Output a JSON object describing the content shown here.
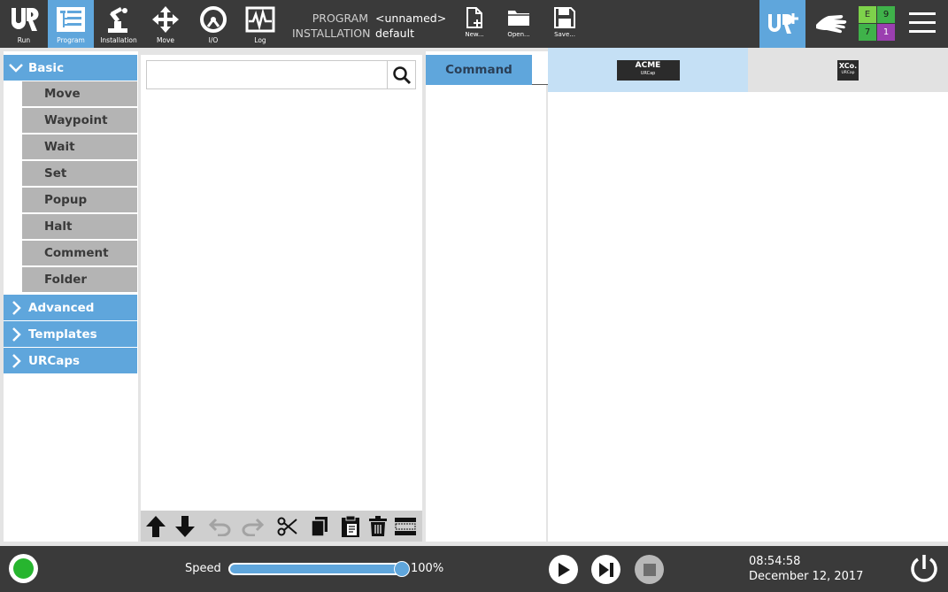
{
  "topbar": {
    "nav": [
      {
        "label": "Run",
        "icon": "ur-logo-icon"
      },
      {
        "label": "Program",
        "icon": "program-tree-icon",
        "active": true
      },
      {
        "label": "Installation",
        "icon": "robot-arm-icon"
      },
      {
        "label": "Move",
        "icon": "move-arrows-icon"
      },
      {
        "label": "I/O",
        "icon": "io-gauge-icon"
      },
      {
        "label": "Log",
        "icon": "log-chart-icon"
      }
    ],
    "program_key": "PROGRAM",
    "program_value": "<unnamed>",
    "installation_key": "INSTALLATION",
    "installation_value": "default",
    "file_actions": [
      {
        "label": "New...",
        "icon": "new-file-icon"
      },
      {
        "label": "Open...",
        "icon": "folder-icon"
      },
      {
        "label": "Save...",
        "icon": "save-icon"
      }
    ],
    "status": {
      "e": "E",
      "e_count": "9",
      "w": "7",
      "w_count": "1",
      "colors": {
        "green_light": "#7ed24b",
        "green": "#3fb24a",
        "purple": "#9b3fb0"
      }
    }
  },
  "left_tree": {
    "basic": {
      "label": "Basic",
      "items": [
        "Move",
        "Waypoint",
        "Wait",
        "Set",
        "Popup",
        "Halt",
        "Comment",
        "Folder"
      ]
    },
    "collapsed": [
      "Advanced",
      "Templates",
      "URCaps"
    ]
  },
  "command": {
    "tab_label": "Command",
    "urcaps": [
      {
        "name": "ACME",
        "sub": "URCap"
      },
      {
        "name": "XCo.",
        "sub": "URCap"
      }
    ]
  },
  "bottombar": {
    "speed_label": "Speed",
    "speed_percent": 100,
    "speed_value": "100%",
    "time": "08:54:58",
    "date": "December 12, 2017"
  },
  "colors": {
    "accent": "#5fa6dc",
    "bar": "#3a3a3a",
    "node": "#b4b4b4"
  }
}
